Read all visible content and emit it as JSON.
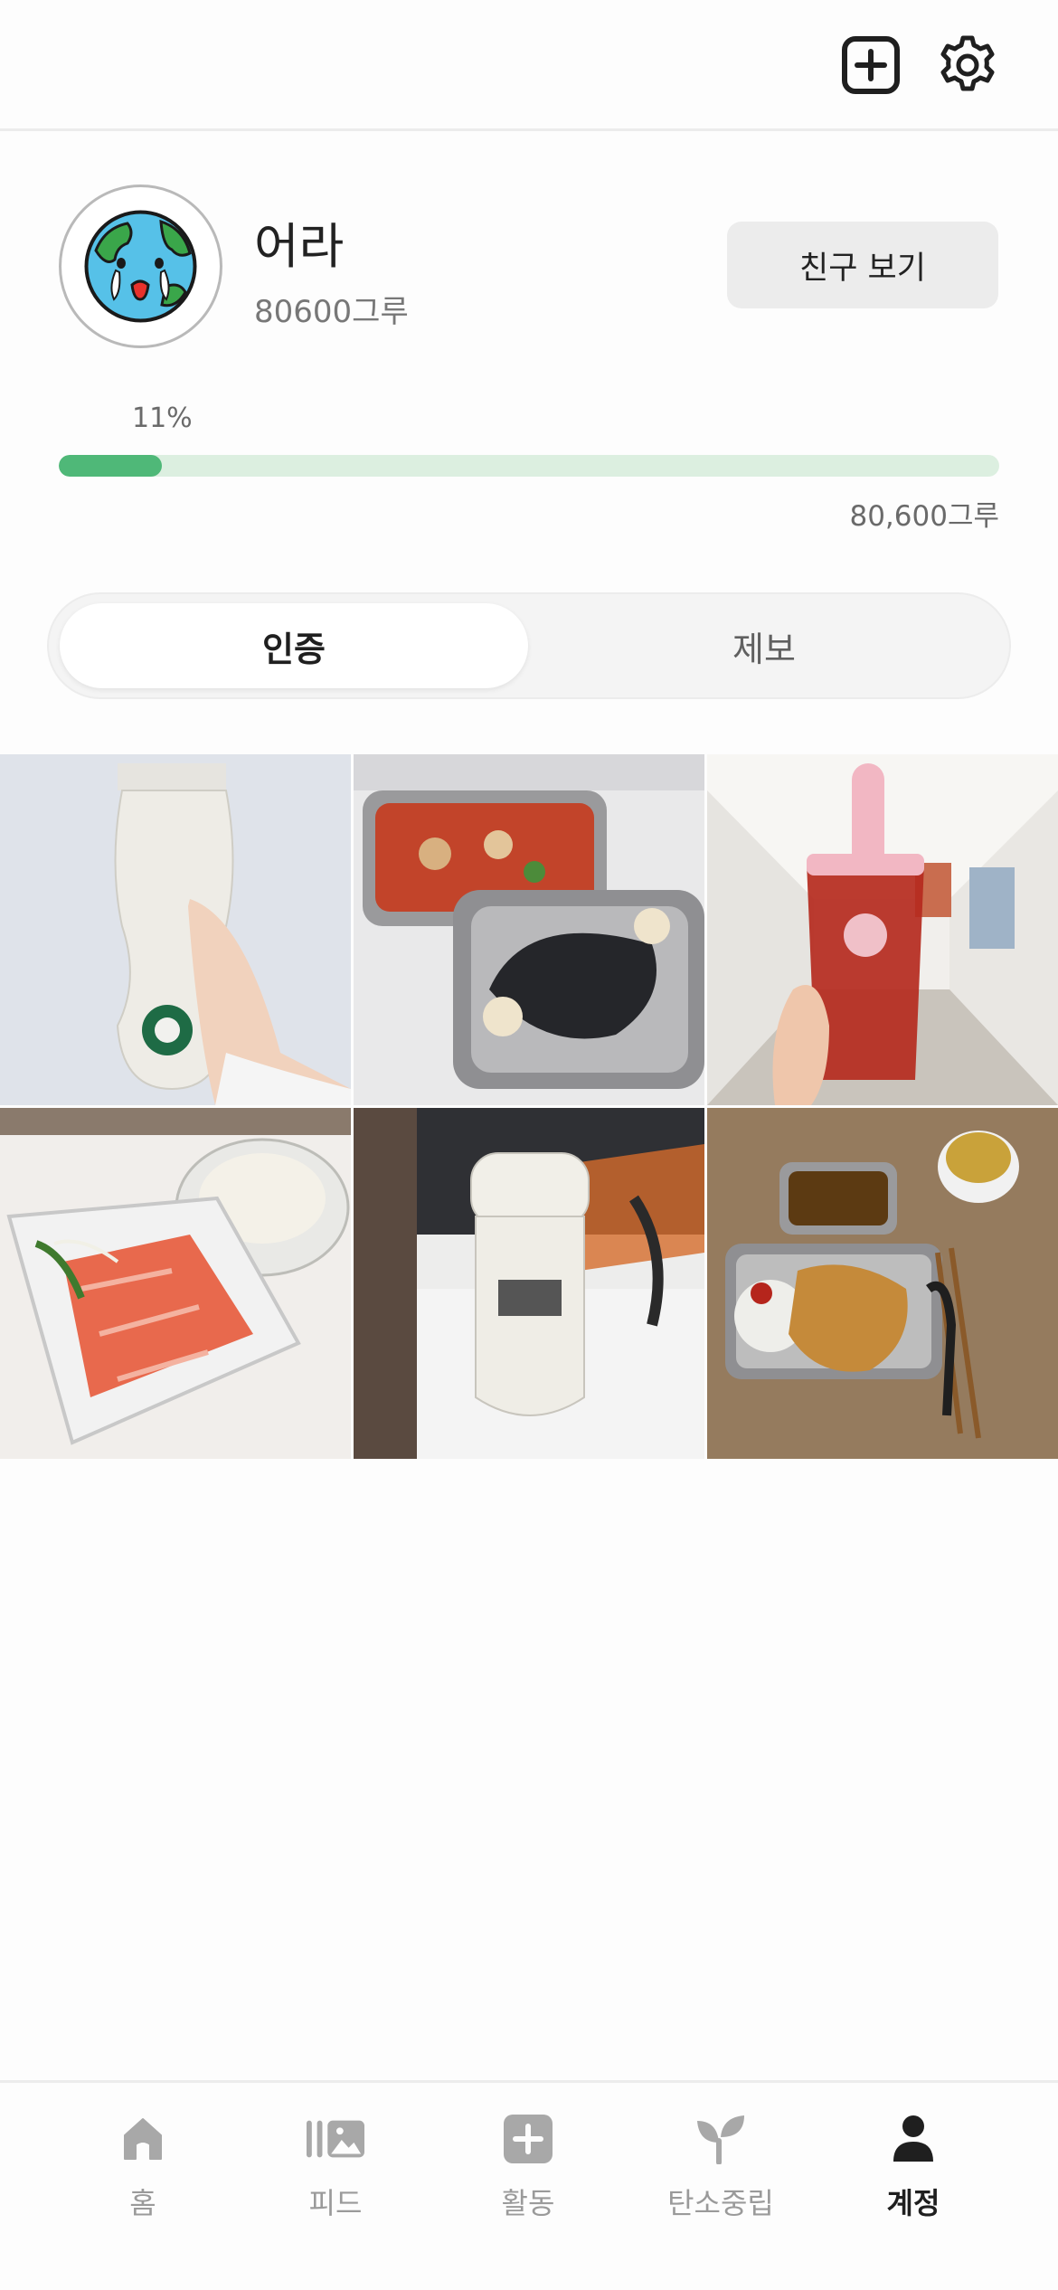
{
  "header": {
    "add_icon": "plus-square-icon",
    "settings_icon": "gear-icon"
  },
  "profile": {
    "name": "어라",
    "points": "80600그루",
    "friend_button": "친구 보기",
    "avatar": "crying-earth-avatar"
  },
  "progress": {
    "percent_label": "11%",
    "percent_value": 11,
    "total_label": "80,600그루",
    "fill_color": "#4fb878",
    "track_color": "#dcefe0"
  },
  "tabs": [
    {
      "label": "인증",
      "active": true
    },
    {
      "label": "제보",
      "active": false
    }
  ],
  "photos": [
    {
      "subject": "white tumbler held in hand"
    },
    {
      "subject": "tteokbokki and gimbap in steel containers"
    },
    {
      "subject": "pink straw cup with iced tea in hallway"
    },
    {
      "subject": "salmon sashimi in plastic container"
    },
    {
      "subject": "white thermos bottle on desk"
    },
    {
      "subject": "pork cutlet with curry in steel containers"
    }
  ],
  "bottom_nav": [
    {
      "label": "홈",
      "icon": "home-icon",
      "active": false
    },
    {
      "label": "피드",
      "icon": "feed-icon",
      "active": false
    },
    {
      "label": "활동",
      "icon": "plus-square-icon",
      "active": false
    },
    {
      "label": "탄소중립",
      "icon": "sprout-icon",
      "active": false
    },
    {
      "label": "계정",
      "icon": "person-icon",
      "active": true
    }
  ]
}
